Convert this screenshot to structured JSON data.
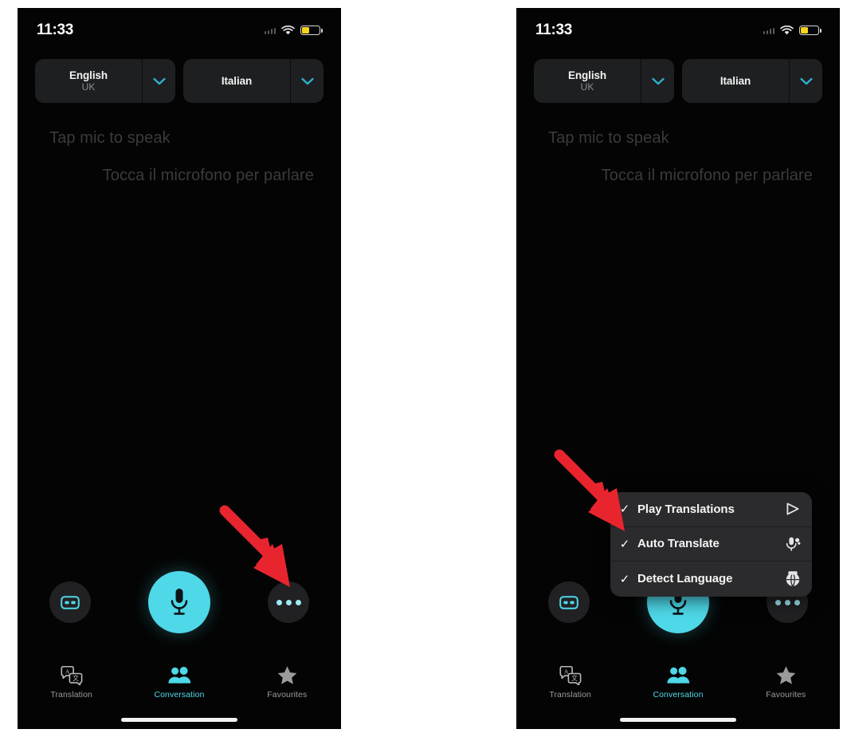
{
  "meta": {
    "app": "Translate",
    "screen": "Conversation",
    "panels": 2,
    "accent_color": "#4ed8e8",
    "background_color": "#040404",
    "menu_background_color": "#2b2b2d",
    "arrow_color": "#e8252f",
    "battery_color": "#f4d41c"
  },
  "status_bar": {
    "time": "11:33",
    "signal_icon": "signal-dots-icon",
    "wifi_icon": "wifi-icon",
    "battery_icon": "battery-low-power-icon"
  },
  "language_bar": {
    "source": {
      "name": "English",
      "region": "UK",
      "chevron_icon": "chevron-down-icon"
    },
    "target": {
      "name": "Italian",
      "region": "",
      "chevron_icon": "chevron-down-icon"
    }
  },
  "conversation": {
    "prompt_source": "Tap mic to speak",
    "prompt_target": "Tocca il microfono per parlare"
  },
  "controls": {
    "left_button": {
      "label": "Side by side view",
      "icon": "card-view-icon"
    },
    "mic_button": {
      "label": "Microphone",
      "icon": "microphone-icon"
    },
    "more_button": {
      "label": "More options",
      "icon": "three-dots-icon"
    }
  },
  "tab_bar": {
    "tabs": [
      {
        "label": "Translation",
        "icon": "translation-bubbles-icon",
        "active": false
      },
      {
        "label": "Conversation",
        "icon": "two-people-icon",
        "active": true
      },
      {
        "label": "Favourites",
        "icon": "star-icon",
        "active": false
      }
    ]
  },
  "menu": {
    "items": [
      {
        "label": "Play Translations",
        "checked": true,
        "check_glyph": "✓",
        "icon": "play-triangle-icon"
      },
      {
        "label": "Auto Translate",
        "checked": true,
        "check_glyph": "✓",
        "icon": "auto-microphone-icon"
      },
      {
        "label": "Detect Language",
        "checked": true,
        "check_glyph": "✓",
        "icon": "detect-language-icon"
      }
    ]
  },
  "annotations": {
    "left_arrow": {
      "target": "more-options-button",
      "direction": "down-right"
    },
    "right_arrow": {
      "target": "options-menu",
      "direction": "down-right"
    }
  }
}
